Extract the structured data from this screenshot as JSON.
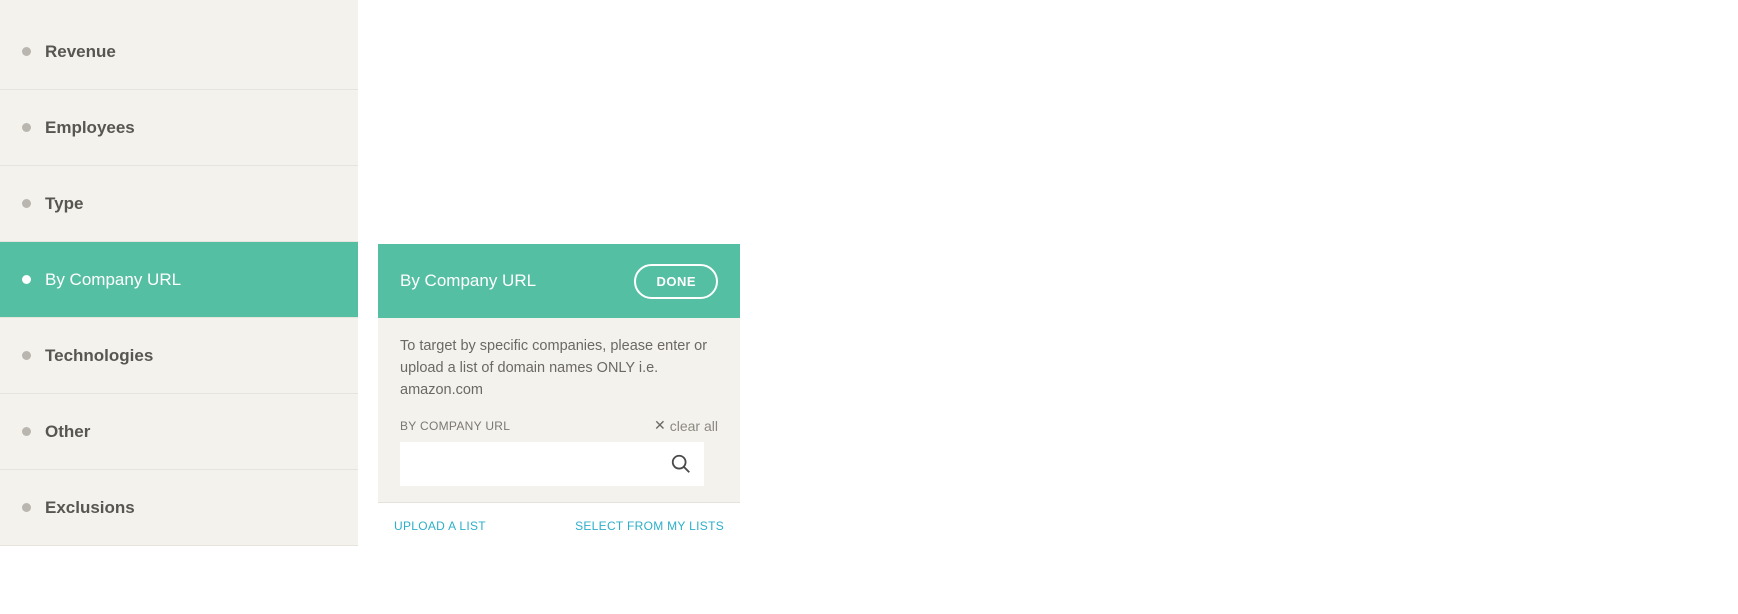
{
  "sidebar": {
    "items": [
      {
        "label": "Revenue"
      },
      {
        "label": "Employees"
      },
      {
        "label": "Type"
      },
      {
        "label": "By Company URL"
      },
      {
        "label": "Technologies"
      },
      {
        "label": "Other"
      },
      {
        "label": "Exclusions"
      }
    ]
  },
  "panel": {
    "title": "By Company URL",
    "done_label": "DONE",
    "description": "To target by specific companies, please enter or upload a list of domain names ONLY i.e. amazon.com",
    "field_label": "BY COMPANY URL",
    "clear_all_label": "clear all",
    "search_value": "",
    "upload_label": "UPLOAD A LIST",
    "select_label": "SELECT FROM MY LISTS"
  }
}
